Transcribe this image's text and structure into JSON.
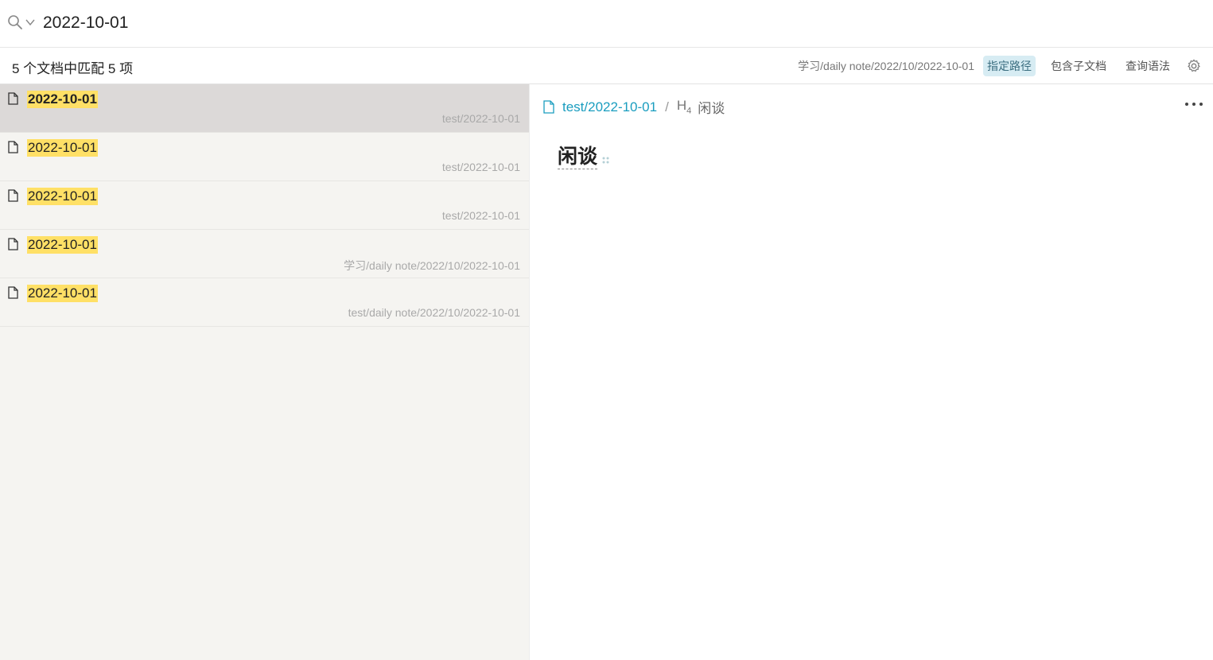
{
  "search": {
    "query": "2022-10-01"
  },
  "toolbar": {
    "match_count": "5 个文档中匹配 5 项",
    "path": "学习/daily note/2022/10/2022-10-01",
    "specify_path": "指定路径",
    "include_children": "包含子文档",
    "query_syntax": "查询语法"
  },
  "results": [
    {
      "title": "2022-10-01",
      "path": "test/2022-10-01"
    },
    {
      "title": "2022-10-01",
      "path": "test/2022-10-01"
    },
    {
      "title": "2022-10-01",
      "path": "test/2022-10-01"
    },
    {
      "title": "2022-10-01",
      "path": "学习/daily note/2022/10/2022-10-01"
    },
    {
      "title": "2022-10-01",
      "path": "test/daily note/2022/10/2022-10-01"
    }
  ],
  "preview": {
    "doc_path": "test/2022-10-01",
    "separator": "/",
    "heading_level_prefix": "H",
    "heading_level_num": "4",
    "heading_label": "闲谈",
    "heading_text": "闲谈"
  },
  "colors": {
    "highlight": "#ffe066",
    "link": "#1a9dbf",
    "active_tag_bg": "#d7ecf3",
    "selected_row": "#dcd9d8",
    "list_bg": "#f5f4f1"
  },
  "icons": {
    "search": "search-icon",
    "chevron": "chevron-down-icon",
    "gear": "gear-icon",
    "doc": "file-icon",
    "more": "more-dots-icon"
  }
}
